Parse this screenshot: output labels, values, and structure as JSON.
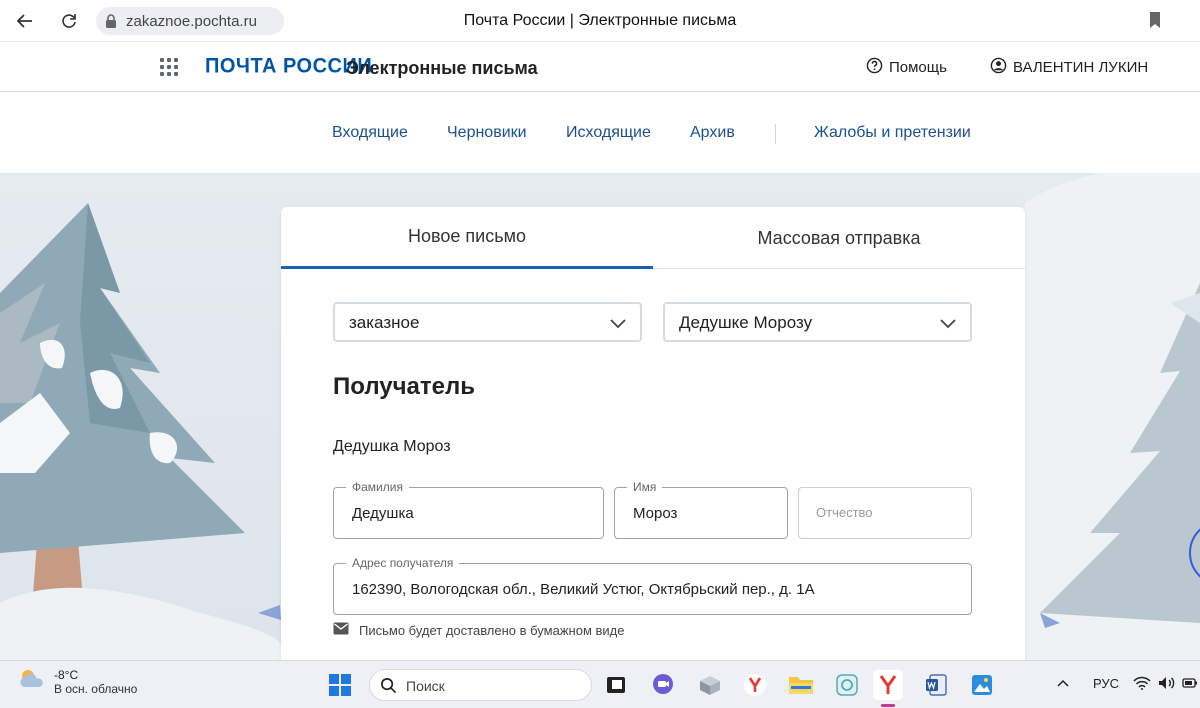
{
  "browser": {
    "url": "zakaznoe.pochta.ru",
    "tab_title": "Почта России | Электронные письма"
  },
  "header": {
    "logo_text": "ПОЧТА РОССИИ",
    "service_title": "Электронные письма",
    "help_label": "Помощь",
    "user_name": "ВАЛЕНТИН ЛУКИН",
    "brand_color": "#0055a6"
  },
  "nav": {
    "items": [
      "Входящие",
      "Черновики",
      "Исходящие",
      "Архив",
      "Жалобы и претензии"
    ]
  },
  "card": {
    "tabs": [
      {
        "label": "Новое письмо",
        "active": true
      },
      {
        "label": "Массовая отправка",
        "active": false
      }
    ],
    "letter_type": "заказное",
    "template": "Дедушке Морозу",
    "section_title": "Получатель",
    "recipient_name": "Дедушка Мороз",
    "fields": {
      "surname": {
        "label": "Фамилия",
        "value": "Дедушка"
      },
      "name": {
        "label": "Имя",
        "value": "Мороз"
      },
      "patronymic": {
        "placeholder": "Отчество"
      },
      "address": {
        "label": "Адрес получателя",
        "value": "162390, Вологодская обл., Великий Устюг, Октябрьский пер., д. 1А"
      }
    },
    "paper_note": "Письмо будет доставлено в бумажном виде",
    "accent_color": "#1a5fb4"
  },
  "taskbar": {
    "weather_temp": "-8°C",
    "weather_desc": "В осн. облачно",
    "search_label": "Поиск",
    "language": "РУС"
  }
}
